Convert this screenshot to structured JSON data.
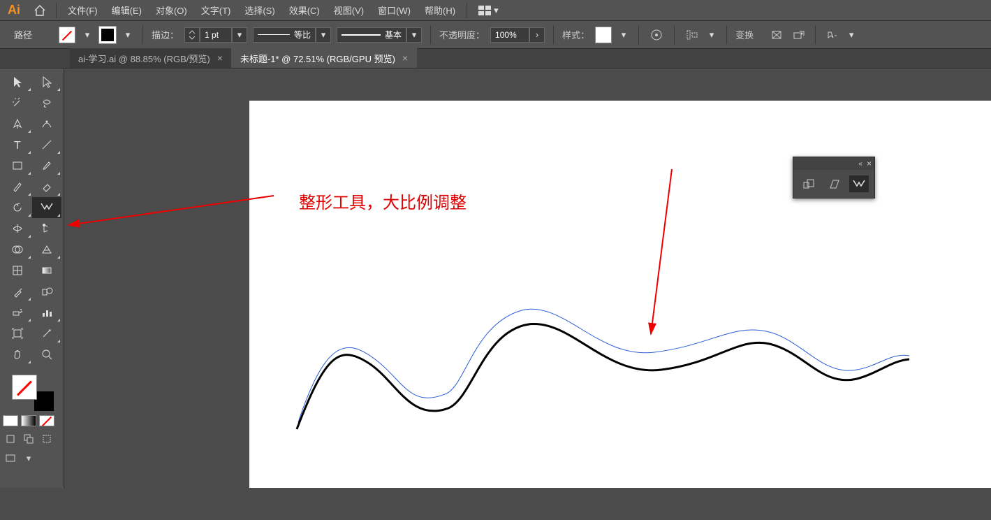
{
  "app": {
    "logo": "Ai"
  },
  "menu": {
    "items": [
      "文件(F)",
      "编辑(E)",
      "对象(O)",
      "文字(T)",
      "选择(S)",
      "效果(C)",
      "视图(V)",
      "窗口(W)",
      "帮助(H)"
    ]
  },
  "options": {
    "selection_label": "路径",
    "stroke_label": "描边：",
    "stroke_value": "1 pt",
    "profile1": "等比",
    "profile2": "基本",
    "opacity_label": "不透明度：",
    "opacity_value": "100%",
    "style_label": "样式：",
    "transform_label": "变换"
  },
  "tabs": [
    {
      "title": "ai-学习.ai @ 88.85% (RGB/预览)",
      "active": false
    },
    {
      "title": "未标题-1* @ 72.51% (RGB/GPU 预览)",
      "active": true
    }
  ],
  "annotation": {
    "text": "整形工具，大比例调整"
  },
  "tools": {
    "rows": [
      [
        "selection",
        "direct-selection"
      ],
      [
        "magic-wand",
        "lasso"
      ],
      [
        "pen",
        "curvature"
      ],
      [
        "type",
        "line"
      ],
      [
        "rectangle",
        "paintbrush"
      ],
      [
        "pencil",
        "eraser"
      ],
      [
        "rotate",
        "reshape"
      ],
      [
        "width",
        "pin"
      ],
      [
        "shape-builder",
        "perspective"
      ],
      [
        "mesh",
        "gradient"
      ],
      [
        "eyedropper",
        "blend"
      ],
      [
        "symbol-sprayer",
        "column-graph"
      ],
      [
        "artboard",
        "slice"
      ],
      [
        "hand",
        "zoom"
      ]
    ],
    "selected": "reshape"
  }
}
